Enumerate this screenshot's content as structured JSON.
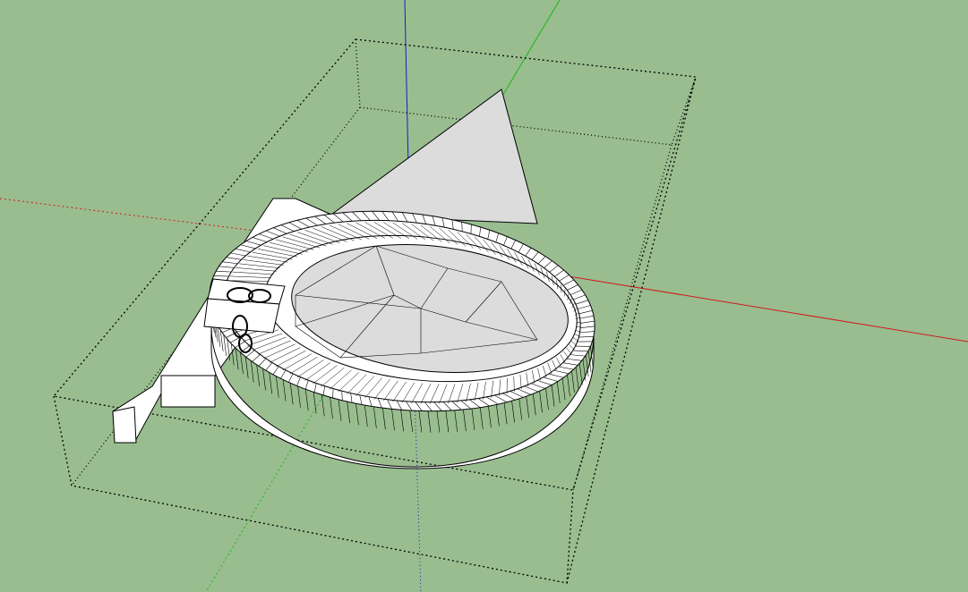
{
  "app": {
    "type": "3d-modeling-viewport",
    "background_color": "#99bd8f"
  },
  "viewport": {
    "axes": {
      "x_color": "#d11a1a",
      "y_color": "#18b818",
      "z_color": "#1a1ad1"
    },
    "model": {
      "description_tag": "circular-dial-with-triangular-fin",
      "face_color": "#ffffff",
      "shaded_face_color": "#dcdcdc",
      "edge_color": "#000000"
    },
    "bounding_box": {
      "line_style": "dotted",
      "color": "#000000"
    }
  }
}
